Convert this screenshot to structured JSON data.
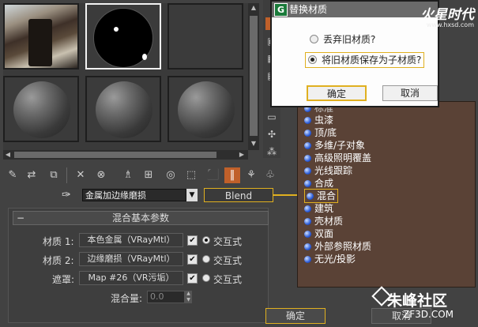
{
  "dialog": {
    "title": "替换材质",
    "icon": "G",
    "option1": "丢弃旧材质?",
    "option2": "将旧材质保存为子材质?",
    "ok": "确定",
    "cancel": "取消"
  },
  "watermark": {
    "brand": "火星时代",
    "url": "www.hxsd.com",
    "site": "朱峰社区",
    "site_url": "ZF3D.COM"
  },
  "toolbar": {
    "material_name": "金属加边缘磨损",
    "material_type": "Blend"
  },
  "rollout": {
    "title": "混合基本参数",
    "rows": [
      {
        "label": "材质 1:",
        "map": "本色金属（VRayMtl）",
        "enabled": true,
        "interactive": true,
        "radio_label": "交互式"
      },
      {
        "label": "材质 2:",
        "map": "边缘磨损（VRayMtl）",
        "enabled": true,
        "interactive": false,
        "radio_label": "交互式"
      },
      {
        "label": "遮罩:",
        "map": "Map #26（VR污垢）",
        "enabled": true,
        "interactive": false,
        "radio_label": "交互式"
      }
    ],
    "mix_label": "混合量:",
    "mix_value": "0.0"
  },
  "type_list": {
    "items": [
      "标准",
      "虫漆",
      "顶/底",
      "多维/子对象",
      "高级照明覆盖",
      "光线跟踪",
      "合成",
      "混合",
      "建筑",
      "壳材质",
      "双面",
      "外部参照材质",
      "无光/投影"
    ],
    "selected": "混合"
  },
  "bottom": {
    "ok": "确定",
    "cancel": "取消"
  }
}
